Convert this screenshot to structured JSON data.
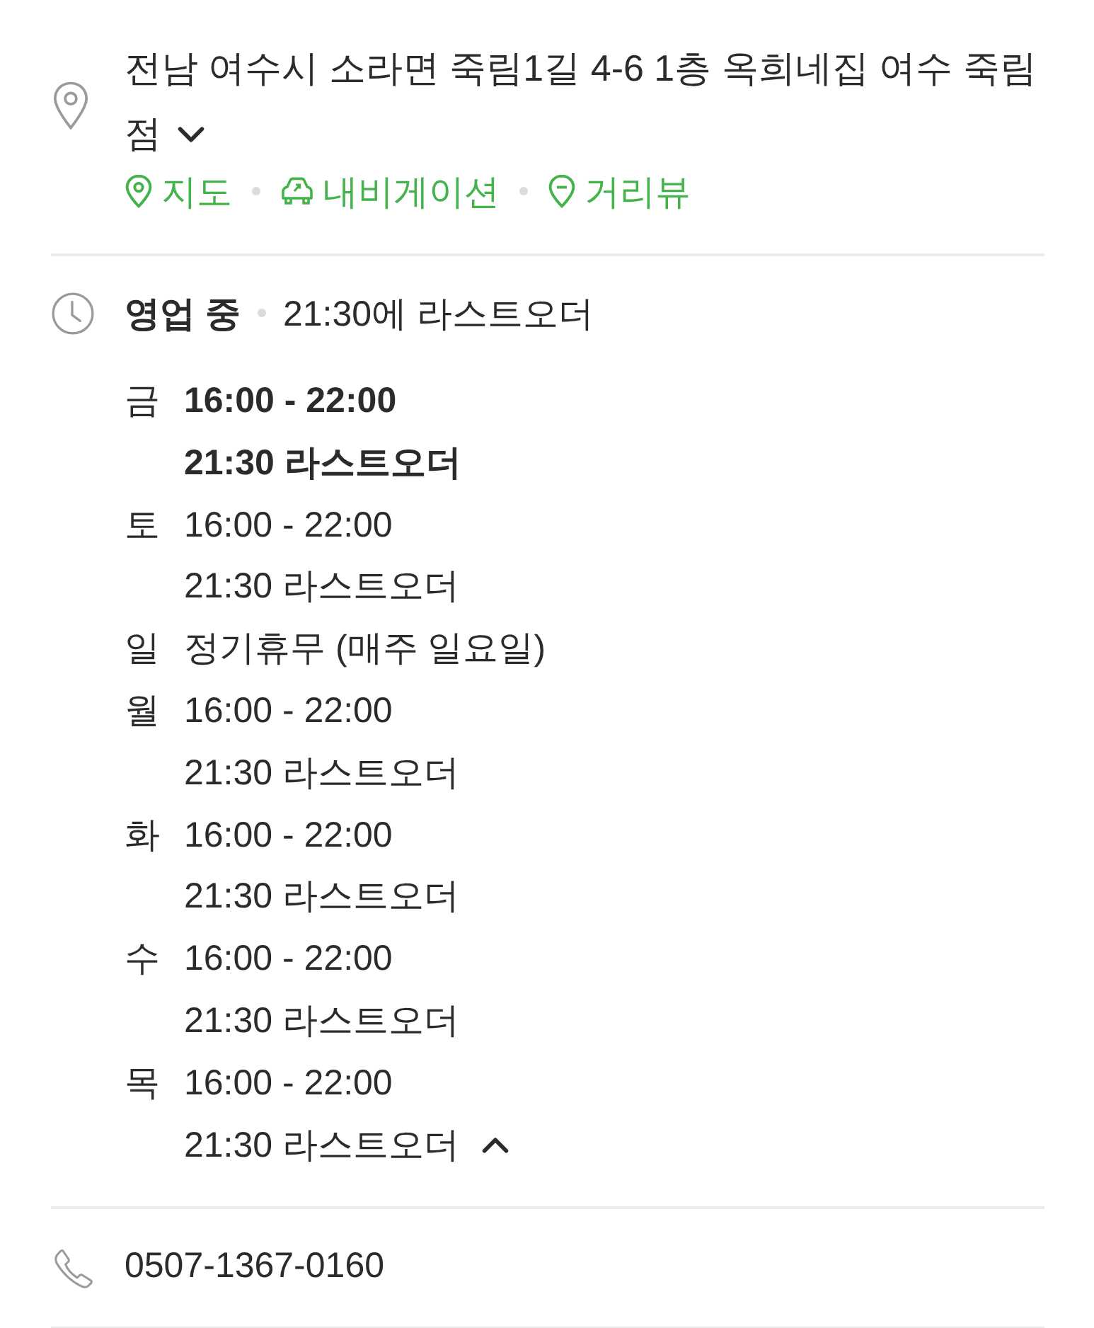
{
  "address": {
    "text": "전남 여수시 소라면 죽림1길 4-6 1층 옥희네집 여수 죽림점",
    "expanded": false
  },
  "links": [
    {
      "kind": "map",
      "label": "지도"
    },
    {
      "kind": "navigation",
      "label": "내비게이션"
    },
    {
      "kind": "street_view",
      "label": "거리뷰"
    }
  ],
  "hours": {
    "status": "영업 중",
    "note": "21:30에 라스트오더",
    "expanded": true,
    "days": [
      {
        "day": "금",
        "current": true,
        "lines": [
          "16:00 - 22:00",
          "21:30 라스트오더"
        ]
      },
      {
        "day": "토",
        "current": false,
        "lines": [
          "16:00 - 22:00",
          "21:30 라스트오더"
        ]
      },
      {
        "day": "일",
        "current": false,
        "lines": [
          "정기휴무 (매주 일요일)"
        ]
      },
      {
        "day": "월",
        "current": false,
        "lines": [
          "16:00 - 22:00",
          "21:30 라스트오더"
        ]
      },
      {
        "day": "화",
        "current": false,
        "lines": [
          "16:00 - 22:00",
          "21:30 라스트오더"
        ]
      },
      {
        "day": "수",
        "current": false,
        "lines": [
          "16:00 - 22:00",
          "21:30 라스트오더"
        ]
      },
      {
        "day": "목",
        "current": false,
        "lines": [
          "16:00 - 22:00",
          "21:30 라스트오더"
        ]
      }
    ]
  },
  "phone": "0507-1367-0160"
}
